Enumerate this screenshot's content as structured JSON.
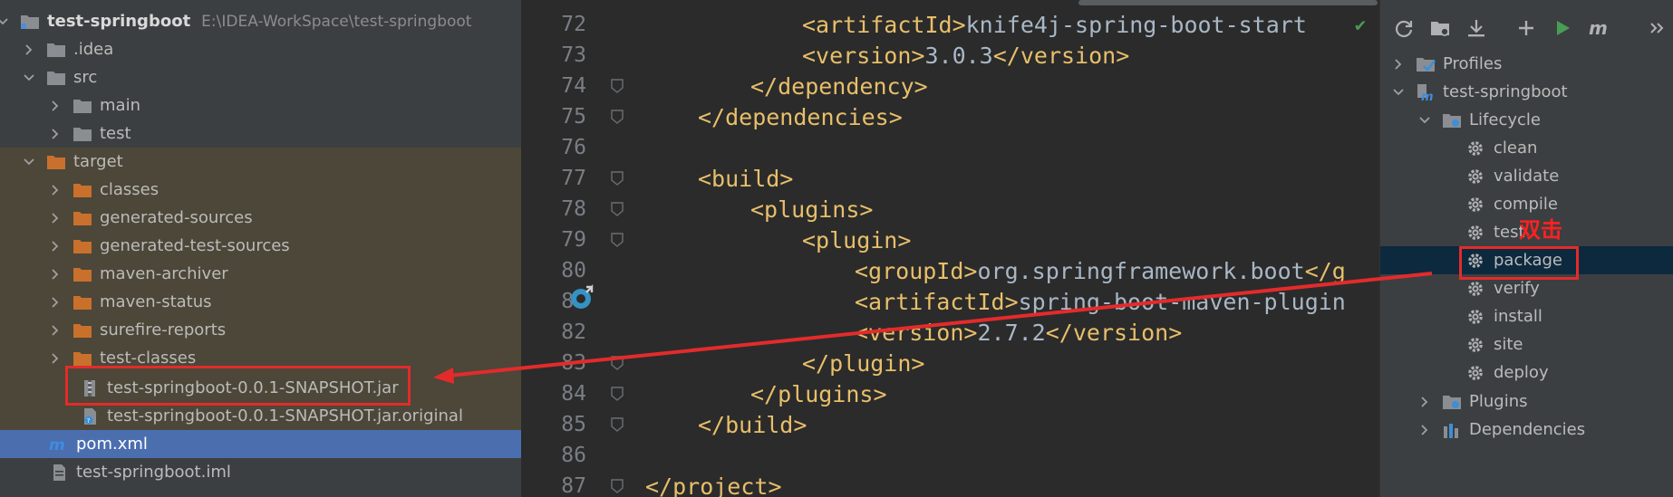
{
  "project_tree": {
    "root": {
      "name": "test-springboot",
      "path": "E:\\IDEA-WorkSpace\\test-springboot"
    },
    "items": [
      {
        "label": ".idea"
      },
      {
        "label": "src"
      },
      {
        "label": "main"
      },
      {
        "label": "test"
      },
      {
        "label": "target"
      },
      {
        "label": "classes"
      },
      {
        "label": "generated-sources"
      },
      {
        "label": "generated-test-sources"
      },
      {
        "label": "maven-archiver"
      },
      {
        "label": "maven-status"
      },
      {
        "label": "surefire-reports"
      },
      {
        "label": "test-classes"
      },
      {
        "label": "test-springboot-0.0.1-SNAPSHOT.jar"
      },
      {
        "label": "test-springboot-0.0.1-SNAPSHOT.jar.original"
      },
      {
        "label": "pom.xml"
      },
      {
        "label": "test-springboot.iml"
      }
    ]
  },
  "editor": {
    "lines": [
      {
        "num": "72",
        "open": "<artifactId>",
        "text": "knife4j-spring-boot-start",
        "close": ""
      },
      {
        "num": "73",
        "open": "<version>",
        "text": "3.0.3",
        "close": "</version>"
      },
      {
        "num": "74",
        "open": "</dependency>",
        "text": "",
        "close": ""
      },
      {
        "num": "75",
        "open": "</dependencies>",
        "text": "",
        "close": ""
      },
      {
        "num": "76",
        "open": "",
        "text": "",
        "close": ""
      },
      {
        "num": "77",
        "open": "<build>",
        "text": "",
        "close": ""
      },
      {
        "num": "78",
        "open": "<plugins>",
        "text": "",
        "close": ""
      },
      {
        "num": "79",
        "open": "<plugin>",
        "text": "",
        "close": ""
      },
      {
        "num": "80",
        "open": "<groupId>",
        "text": "org.springframework.boot",
        "close": "</g"
      },
      {
        "num": "81",
        "open": "<artifactId>",
        "text": "spring-boot-maven-plugin",
        "close": ""
      },
      {
        "num": "82",
        "open": "<version>",
        "text": "2.7.2",
        "close": "</version>"
      },
      {
        "num": "83",
        "open": "</plugin>",
        "text": "",
        "close": ""
      },
      {
        "num": "84",
        "open": "</plugins>",
        "text": "",
        "close": ""
      },
      {
        "num": "85",
        "open": "</build>",
        "text": "",
        "close": ""
      },
      {
        "num": "86",
        "open": "",
        "text": "",
        "close": ""
      },
      {
        "num": "87",
        "open": "</project>",
        "text": "",
        "close": ""
      }
    ]
  },
  "maven": {
    "profiles": "Profiles",
    "project": "test-springboot",
    "lifecycle": "Lifecycle",
    "phases": [
      "clean",
      "validate",
      "compile",
      "test",
      "package",
      "verify",
      "install",
      "site",
      "deploy"
    ],
    "plugins": "Plugins",
    "dependencies": "Dependencies"
  },
  "annotation": {
    "note": "双击",
    "color": "#e32b2b"
  }
}
